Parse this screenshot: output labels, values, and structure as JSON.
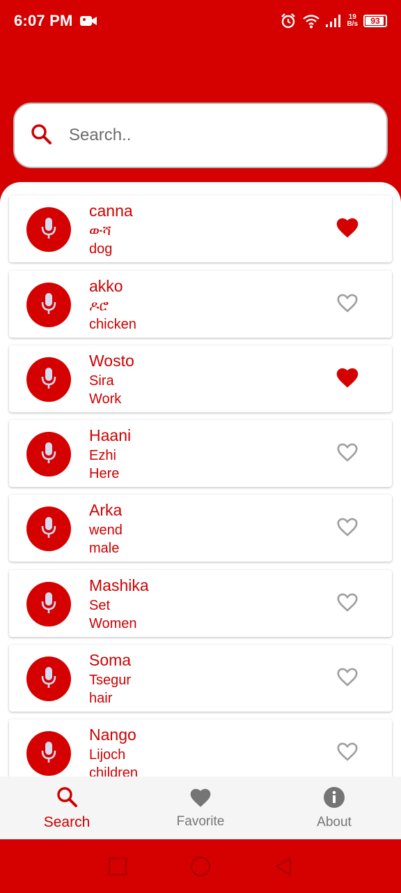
{
  "status_bar": {
    "time": "6:07 PM",
    "speed_value": "19",
    "speed_unit": "B/s",
    "battery": "93",
    "battery_level": 0.93
  },
  "search": {
    "placeholder": "Search.."
  },
  "colors": {
    "primary": "#d50000",
    "text_red": "#cc0000",
    "heart_inactive": "#9e9e9e"
  },
  "entries": [
    {
      "word": "canna",
      "translation": "ውሻ",
      "english": "dog",
      "favorite": true
    },
    {
      "word": "akko",
      "translation": "ዶሮ",
      "english": "chicken",
      "favorite": false
    },
    {
      "word": "Wosto",
      "translation": "Sira",
      "english": "Work",
      "favorite": true
    },
    {
      "word": "Haani",
      "translation": "Ezhi",
      "english": "Here",
      "favorite": false
    },
    {
      "word": "Arka",
      "translation": "wend",
      "english": "male",
      "favorite": false
    },
    {
      "word": "Mashika",
      "translation": "Set",
      "english": "Women",
      "favorite": false
    },
    {
      "word": "Soma",
      "translation": "Tsegur",
      "english": "hair",
      "favorite": false
    },
    {
      "word": "Nango",
      "translation": "Lijoch",
      "english": "children",
      "favorite": false
    }
  ],
  "bottom_nav": {
    "search_label": "Search",
    "favorite_label": "Favorite",
    "about_label": "About",
    "active": "search"
  }
}
